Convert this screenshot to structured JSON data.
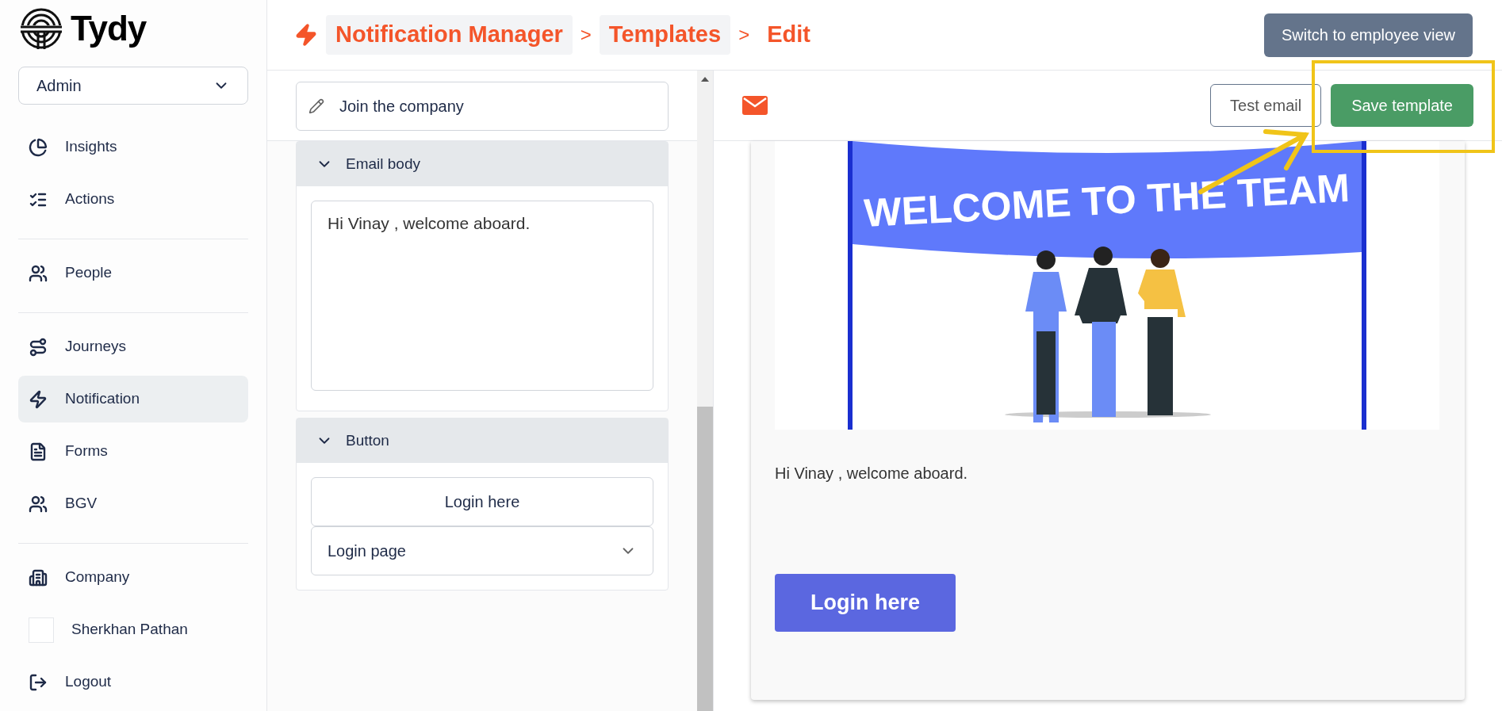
{
  "sidebar": {
    "logo": "Tydy",
    "role_select": {
      "value": "Admin"
    },
    "groups": [
      [
        {
          "label": "Insights",
          "selected": false
        },
        {
          "label": "Actions",
          "selected": false
        }
      ],
      [
        {
          "label": "People",
          "selected": false
        }
      ],
      [
        {
          "label": "Journeys",
          "selected": false
        },
        {
          "label": "Notification",
          "selected": true
        },
        {
          "label": "Forms",
          "selected": false
        },
        {
          "label": "BGV",
          "selected": false
        }
      ],
      [
        {
          "label": "Company",
          "selected": false
        },
        {
          "label": "Sherkhan Pathan",
          "selected": false
        },
        {
          "label": "Logout",
          "selected": false
        }
      ]
    ]
  },
  "breadcrumb": [
    {
      "label": "Notification Manager",
      "current": false
    },
    {
      "label": "Templates",
      "current": false
    },
    {
      "label": "Edit",
      "current": true
    }
  ],
  "breadcrumb_separator": ">",
  "switch_view_button": "Switch to employee view",
  "editor": {
    "subject": {
      "value": "Join the company"
    },
    "sections": [
      {
        "title": "Email body",
        "expanded": true,
        "kind": "body",
        "body": {
          "value": "Hi Vinay , welcome aboard."
        }
      },
      {
        "title": "Button",
        "expanded": true,
        "kind": "button",
        "button_text": {
          "value": "Login here"
        },
        "link_select": {
          "value": "Login page"
        }
      }
    ]
  },
  "preview": {
    "test_button": "Test email",
    "save_button": "Save template",
    "banner_text": "WELCOME TO THE TEAM",
    "message": "Hi Vinay , welcome aboard.",
    "cta_button": "Login here"
  }
}
